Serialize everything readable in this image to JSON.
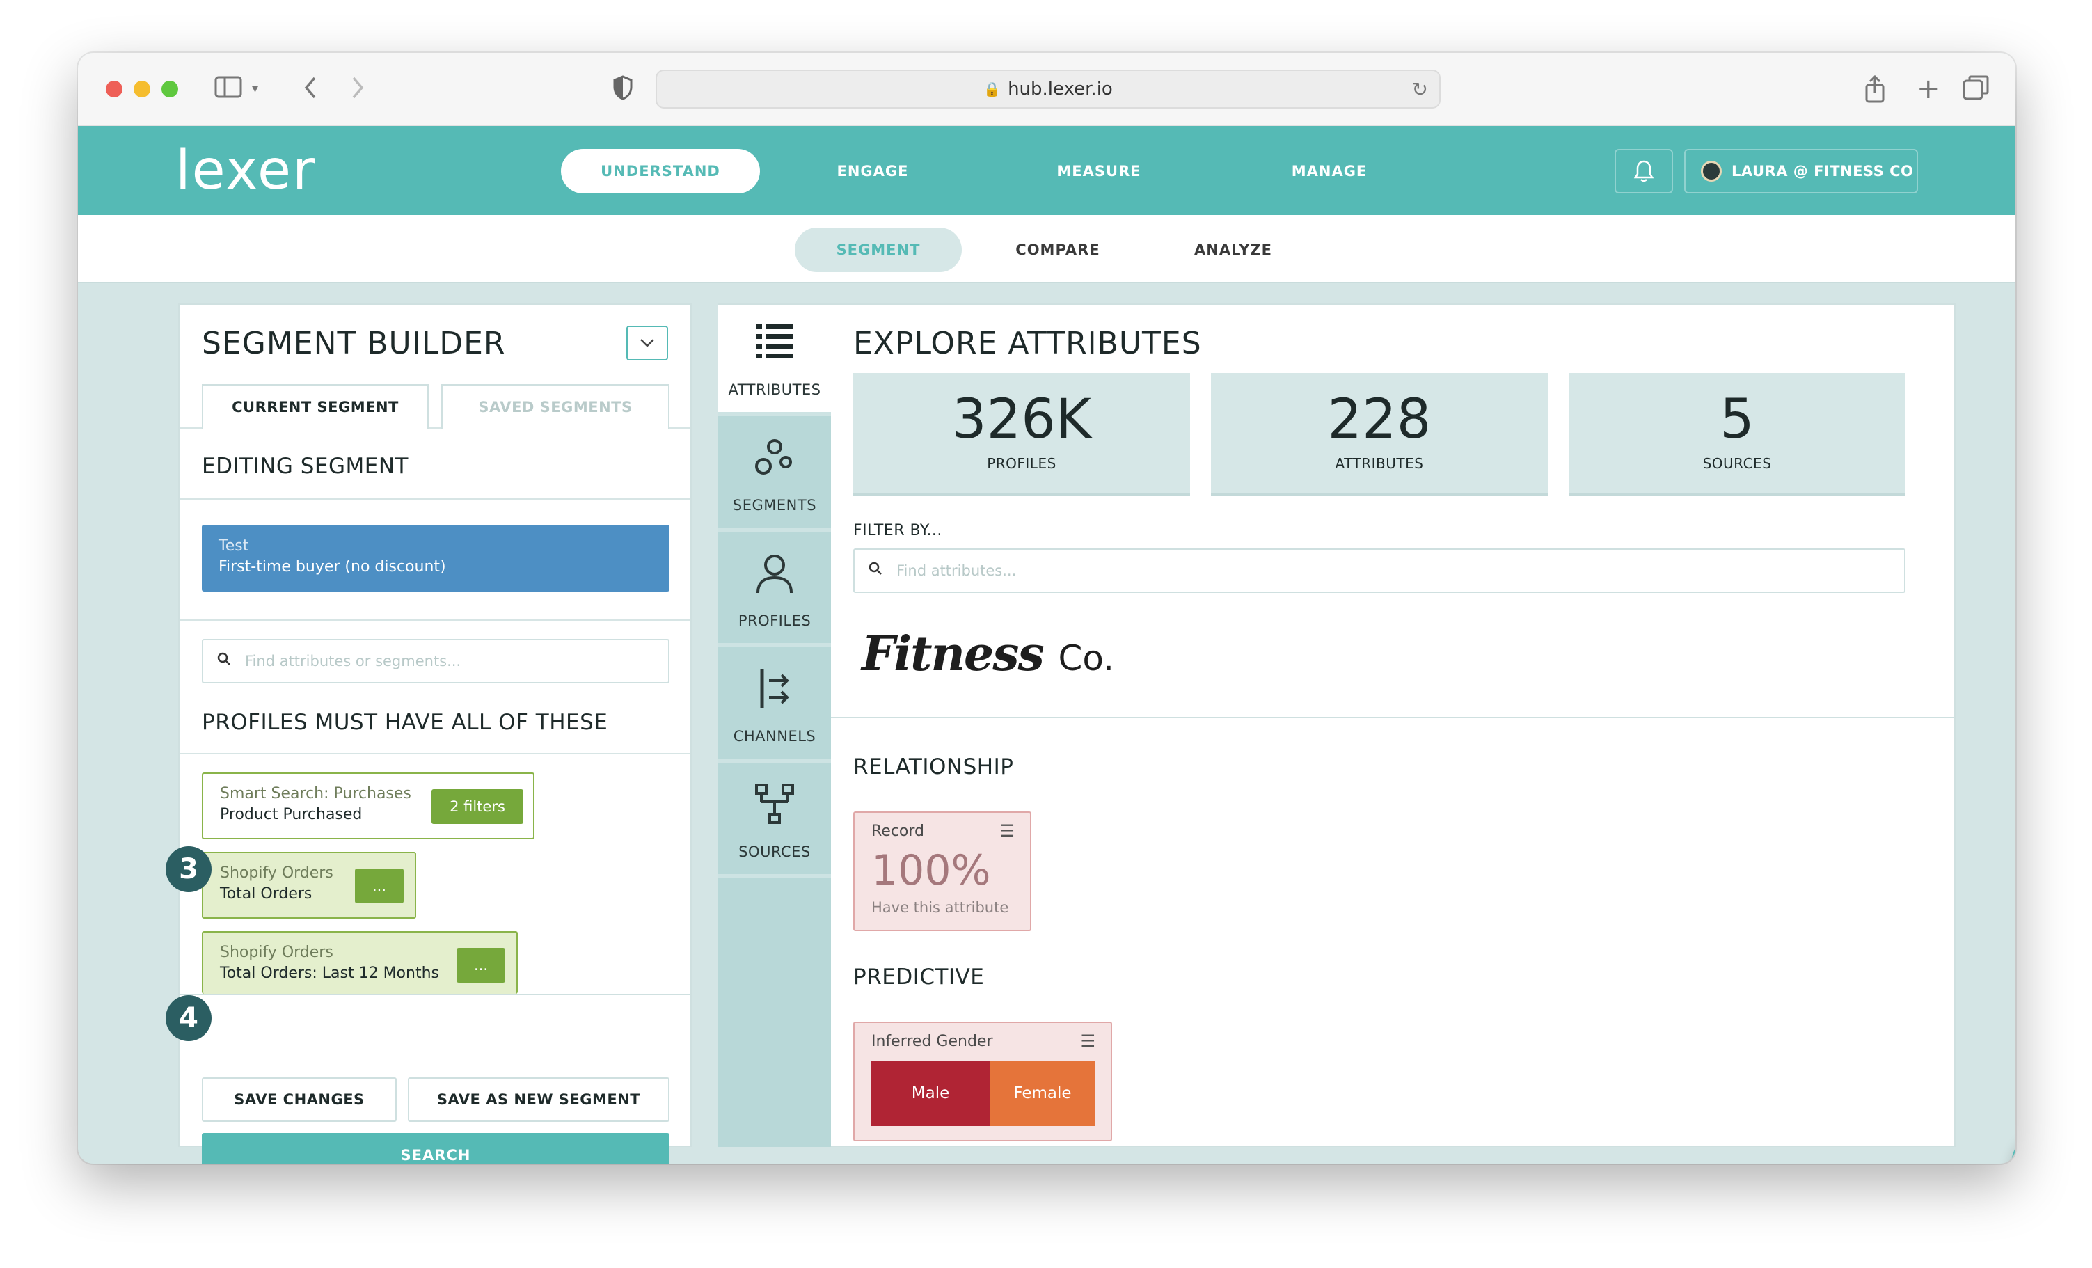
{
  "browser": {
    "url": "hub.lexer.io"
  },
  "app": {
    "logo": "lexer",
    "nav": [
      "UNDERSTAND",
      "ENGAGE",
      "MEASURE",
      "MANAGE"
    ],
    "user": "LAURA @ FITNESS CO"
  },
  "subnav": [
    "SEGMENT",
    "COMPARE",
    "ANALYZE"
  ],
  "segment_builder": {
    "title": "SEGMENT BUILDER",
    "tabs": [
      "CURRENT SEGMENT",
      "SAVED SEGMENTS"
    ],
    "editing_heading": "EDITING SEGMENT",
    "segment": {
      "label": "Test",
      "name": "First-time buyer (no discount)"
    },
    "search_placeholder": "Find attributes or segments...",
    "must_have_heading": "PROFILES MUST HAVE ALL OF THESE",
    "filters": [
      {
        "source": "Smart Search: Purchases",
        "name": "Product Purchased",
        "badge": "2 filters"
      },
      {
        "source": "Shopify Orders",
        "name": "Total Orders",
        "badge": "..."
      },
      {
        "source": "Shopify Orders",
        "name": "Total Orders: Last 12 Months",
        "badge": "..."
      }
    ],
    "steps": [
      "3",
      "4"
    ],
    "buttons": {
      "save": "SAVE CHANGES",
      "save_new": "SAVE AS NEW SEGMENT",
      "search": "SEARCH"
    }
  },
  "rail": [
    "ATTRIBUTES",
    "SEGMENTS",
    "PROFILES",
    "CHANNELS",
    "SOURCES"
  ],
  "explore": {
    "title": "EXPLORE ATTRIBUTES",
    "stats": [
      {
        "value": "326K",
        "label": "PROFILES"
      },
      {
        "value": "228",
        "label": "ATTRIBUTES"
      },
      {
        "value": "5",
        "label": "SOURCES"
      }
    ],
    "filter_label": "FILTER BY...",
    "filter_placeholder": "Find attributes...",
    "brand": {
      "script": "Fitness",
      "suffix": "Co."
    },
    "relationship_heading": "RELATIONSHIP",
    "record_card": {
      "name": "Record",
      "value": "100%",
      "caption": "Have this attribute"
    },
    "predictive_heading": "PREDICTIVE",
    "gender_card": {
      "name": "Inferred Gender",
      "segments": [
        "Male",
        "Female"
      ]
    }
  },
  "colors": {
    "teal": "#55bab5",
    "segment_blue": "#4d8fc4",
    "filter_green": "#76a83b",
    "male_red": "#b02434",
    "female_orange": "#e5743a"
  }
}
